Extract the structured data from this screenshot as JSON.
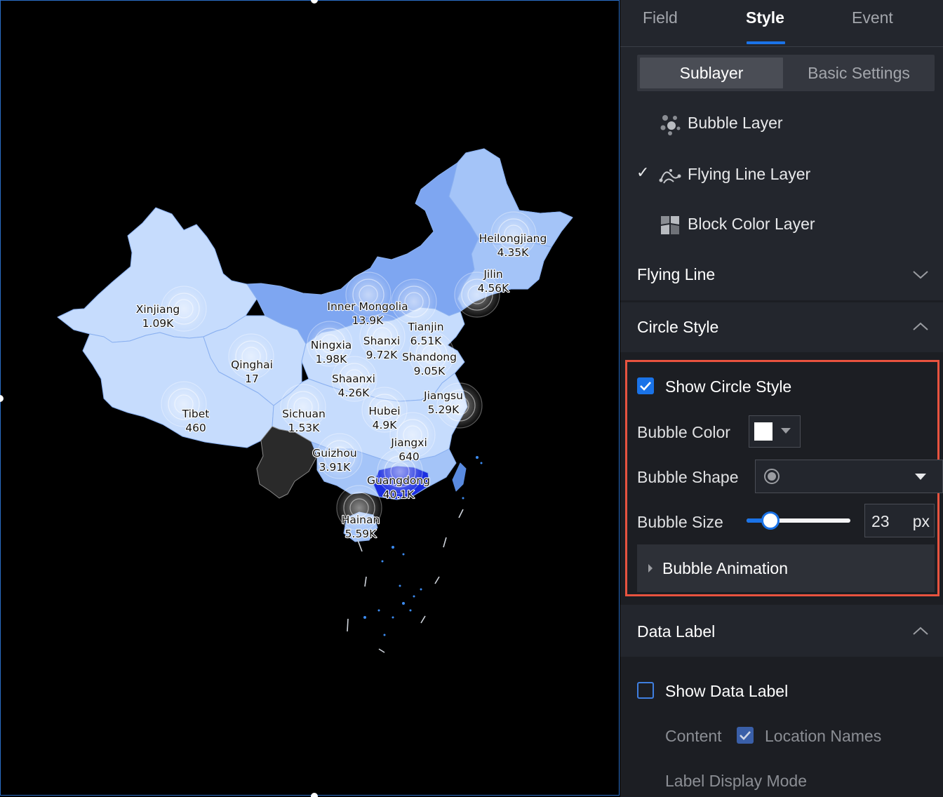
{
  "map": {
    "provinces": [
      {
        "name": "Heilongjiang",
        "value": "4.35K"
      },
      {
        "name": "Jilin",
        "value": "4.56K"
      },
      {
        "name": "Xinjiang",
        "value": "1.09K"
      },
      {
        "name": "Inner Mongolia",
        "value": "13.9K"
      },
      {
        "name": "Tianjin",
        "value": "6.51K"
      },
      {
        "name": "Ningxia",
        "value": "1.98K"
      },
      {
        "name": "Shanxi",
        "value": "9.72K"
      },
      {
        "name": "Shandong",
        "value": "9.05K"
      },
      {
        "name": "Qinghai",
        "value": "17"
      },
      {
        "name": "Shaanxi",
        "value": "4.26K"
      },
      {
        "name": "Jiangsu",
        "value": "5.29K"
      },
      {
        "name": "Tibet",
        "value": "460"
      },
      {
        "name": "Sichuan",
        "value": "1.53K"
      },
      {
        "name": "Hubei",
        "value": "4.9K"
      },
      {
        "name": "Jiangxi",
        "value": "640"
      },
      {
        "name": "Guizhou",
        "value": "3.91K"
      },
      {
        "name": "Guangdong",
        "value": "40.1K"
      },
      {
        "name": "Hainan",
        "value": "5.59K"
      }
    ],
    "colors": {
      "light": "#c6dcfd",
      "mid": "#a4c4f8",
      "strong": "#7ea6f1",
      "deep": "#1b2ee0",
      "unmapped": "#2a2a2a"
    }
  },
  "panel": {
    "tabs": [
      {
        "label": "Field",
        "active": false
      },
      {
        "label": "Style",
        "active": true
      },
      {
        "label": "Event",
        "active": false
      }
    ],
    "segment": {
      "items": [
        "Sublayer",
        "Basic Settings"
      ],
      "active": "Sublayer"
    },
    "layers": [
      {
        "label": "Bubble Layer",
        "icon": "bubble-layer-icon",
        "checked": false
      },
      {
        "label": "Flying Line Layer",
        "icon": "flying-line-icon",
        "checked": true
      },
      {
        "label": "Block Color Layer",
        "icon": "block-color-icon",
        "checked": false
      }
    ],
    "sections": {
      "flying_line": {
        "label": "Flying Line",
        "expanded": false
      },
      "circle_style": {
        "label": "Circle Style",
        "expanded": true,
        "show_label": "Show Circle Style",
        "show_checked": true,
        "bubble_color_label": "Bubble Color",
        "bubble_color": "#ffffff",
        "bubble_shape_label": "Bubble Shape",
        "bubble_shape": "circle-dot-icon",
        "bubble_size_label": "Bubble Size",
        "bubble_size": "23",
        "bubble_size_unit": "px",
        "bubble_size_fraction": 0.23,
        "animation_label": "Bubble Animation"
      },
      "data_label": {
        "label": "Data Label",
        "expanded": true,
        "show_label": "Show Data Label",
        "show_checked": false,
        "content_label": "Content",
        "location_names_label": "Location Names",
        "location_names_checked": true,
        "display_mode_label": "Label Display Mode"
      }
    },
    "accent": "#1a73e8",
    "highlight_border": "#e8533f"
  }
}
